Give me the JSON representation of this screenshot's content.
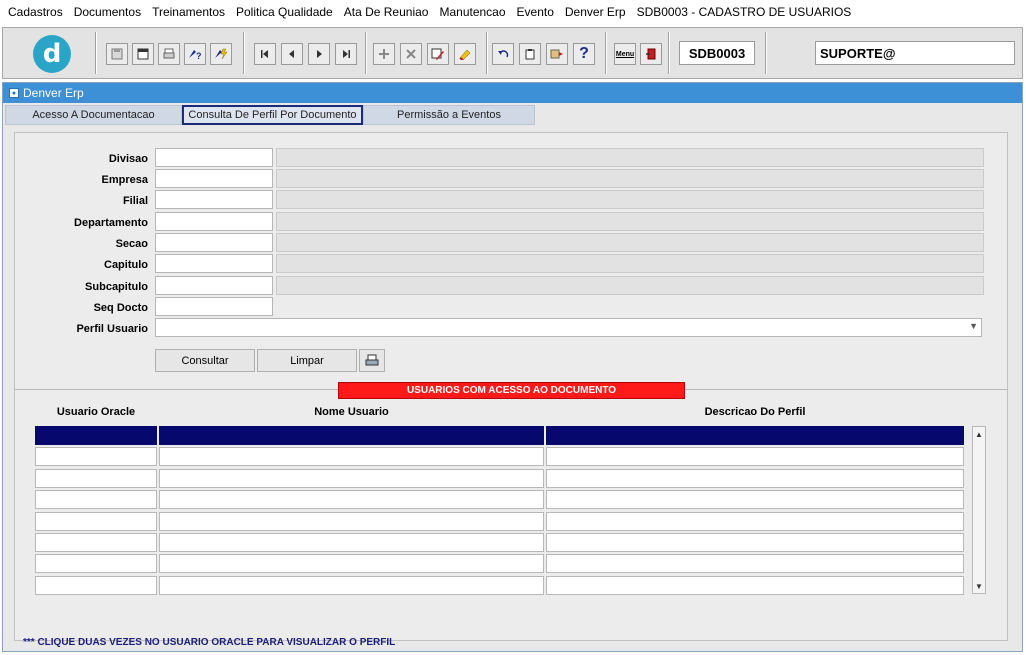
{
  "menu": [
    "Cadastros",
    "Documentos",
    "Treinamentos",
    "Politica Qualidade",
    "Ata De Reuniao",
    "Manutencao",
    "Evento",
    "Denver Erp",
    "SDB0003 - CADASTRO DE USUARIOS"
  ],
  "toolbar": {
    "logo_letter": "d",
    "form_code": "SDB0003",
    "user": "SUPORTE@",
    "icons": [
      "save-icon",
      "window-icon",
      "print-icon",
      "help-query-icon",
      "execute-query-icon",
      "first-record-icon",
      "previous-record-icon",
      "next-record-icon",
      "last-record-icon",
      "insert-record-icon",
      "delete-record-icon",
      "edit-icon",
      "clear-icon",
      "undo-icon",
      "clipboard-icon",
      "list-icon",
      "help-icon",
      "menu-icon",
      "exit-icon"
    ],
    "help_glyph": "?",
    "menu_glyph": "Menu"
  },
  "window": {
    "title": "Denver Erp",
    "tabs": [
      "Acesso A Documentacao",
      "Consulta De Perfil Por Documento",
      "Permissão a Eventos"
    ]
  },
  "form": {
    "fields": [
      {
        "label": "Divisao",
        "value": "",
        "desc": ""
      },
      {
        "label": "Empresa",
        "value": "",
        "desc": ""
      },
      {
        "label": "Filial",
        "value": "",
        "desc": ""
      },
      {
        "label": "Departamento",
        "value": "",
        "desc": ""
      },
      {
        "label": "Secao",
        "value": "",
        "desc": ""
      },
      {
        "label": "Capitulo",
        "value": "",
        "desc": ""
      },
      {
        "label": "Subcapitulo",
        "value": "",
        "desc": ""
      },
      {
        "label": "Seq Docto",
        "value": ""
      }
    ],
    "perfil_label": "Perfil Usuario",
    "perfil_value": "",
    "buttons": {
      "consultar": "Consultar",
      "limpar": "Limpar"
    }
  },
  "results": {
    "title": "USUARIOS COM ACESSO AO DOCUMENTO",
    "columns": [
      "Usuario Oracle",
      "Nome Usuario",
      "Descricao Do Perfil"
    ],
    "rows": [
      [
        "",
        "",
        ""
      ],
      [
        "",
        "",
        ""
      ],
      [
        "",
        "",
        ""
      ],
      [
        "",
        "",
        ""
      ],
      [
        "",
        "",
        ""
      ],
      [
        "",
        "",
        ""
      ],
      [
        "",
        "",
        ""
      ],
      [
        "",
        "",
        ""
      ]
    ]
  },
  "hint": "*** CLIQUE DUAS VEZES NO USUARIO ORACLE PARA VISUALIZAR O PERFIL",
  "colors": {
    "title_bar": "#3d8fd6",
    "selected_row": "#06086e",
    "section_title": "#ff1a1a",
    "hint_text": "#1b1d7a"
  }
}
